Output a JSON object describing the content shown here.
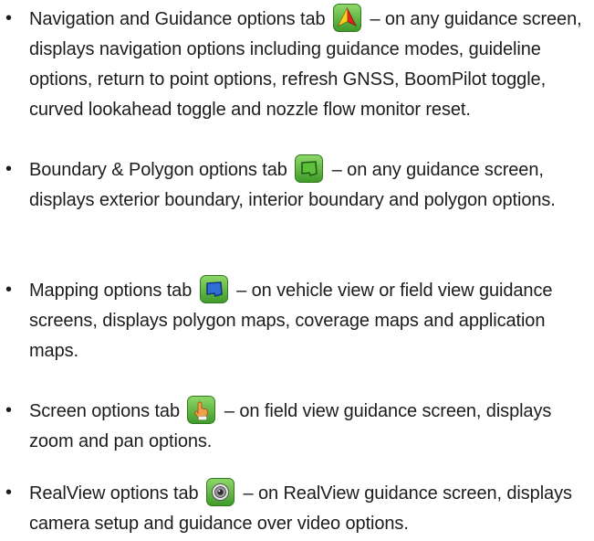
{
  "items": [
    {
      "lead": "Navigation and Guidance options tab",
      "icon": "navigation-arrow-icon",
      "desc": "– on any guidance screen, displays navigation options including guidance modes, guideline options, return to point options, refresh GNSS, BoomPilot toggle, curved lookahead toggle and nozzle flow monitor reset."
    },
    {
      "lead": "Boundary & Polygon options tab",
      "icon": "boundary-polygon-icon",
      "desc": "– on any guidance screen, displays exterior boundary, interior boundary and polygon options."
    },
    {
      "lead": "Mapping options tab",
      "icon": "mapping-icon",
      "desc": "– on vehicle view or field view guidance screens, displays polygon maps, coverage maps and application maps."
    },
    {
      "lead": "Screen options tab",
      "icon": "hand-pointer-icon",
      "desc": "– on field view guidance screen, displays zoom and pan options."
    },
    {
      "lead": "RealView options tab",
      "icon": "camera-lens-icon",
      "desc": "– on RealView guidance screen, displays camera setup and guidance over video options."
    }
  ],
  "bullet": "•"
}
